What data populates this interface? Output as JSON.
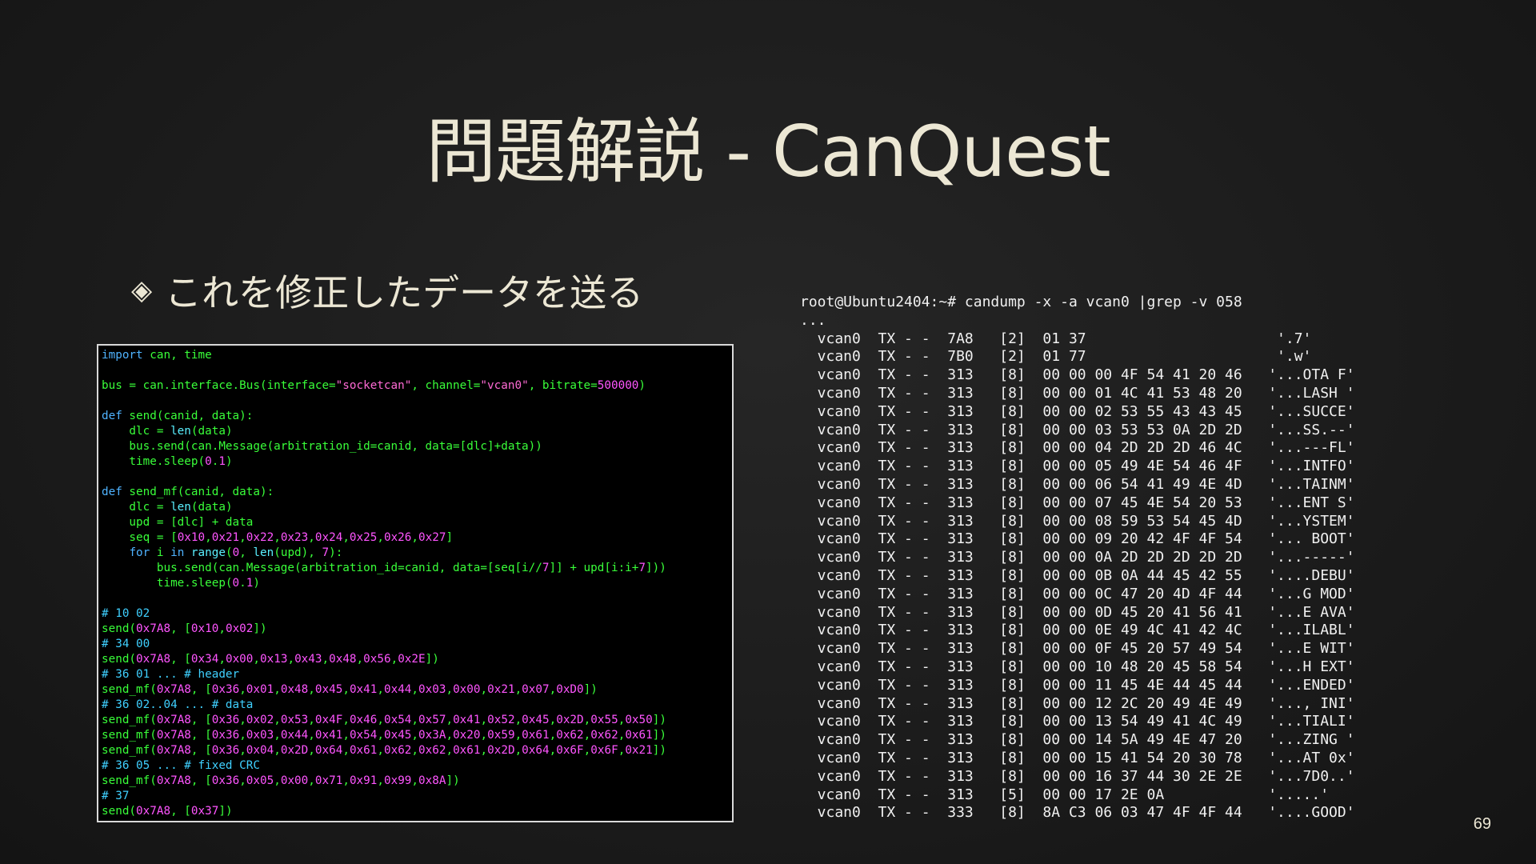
{
  "slide": {
    "title": "問題解説 - CanQuest",
    "bullet": "これを修正したデータを送る",
    "page_number": "69"
  },
  "code_lines": [
    "import can, time",
    "",
    "bus = can.interface.Bus(interface=\"socketcan\", channel=\"vcan0\", bitrate=500000)",
    "",
    "def send(canid, data):",
    "    dlc = len(data)",
    "    bus.send(can.Message(arbitration_id=canid, data=[dlc]+data))",
    "    time.sleep(0.1)",
    "",
    "def send_mf(canid, data):",
    "    dlc = len(data)",
    "    upd = [dlc] + data",
    "    seq = [0x10,0x21,0x22,0x23,0x24,0x25,0x26,0x27]",
    "    for i in range(0, len(upd), 7):",
    "        bus.send(can.Message(arbitration_id=canid, data=[seq[i//7]] + upd[i:i+7]))",
    "        time.sleep(0.1)",
    "",
    "# 10 02",
    "send(0x7A8, [0x10,0x02])",
    "# 34 00",
    "send(0x7A8, [0x34,0x00,0x13,0x43,0x48,0x56,0x2E])",
    "# 36 01 ... # header",
    "send_mf(0x7A8, [0x36,0x01,0x48,0x45,0x41,0x44,0x03,0x00,0x21,0x07,0xD0])",
    "# 36 02..04 ... # data",
    "send_mf(0x7A8, [0x36,0x02,0x53,0x4F,0x46,0x54,0x57,0x41,0x52,0x45,0x2D,0x55,0x50])",
    "send_mf(0x7A8, [0x36,0x03,0x44,0x41,0x54,0x45,0x3A,0x20,0x59,0x61,0x62,0x62,0x61])",
    "send_mf(0x7A8, [0x36,0x04,0x2D,0x64,0x61,0x62,0x62,0x61,0x2D,0x64,0x6F,0x6F,0x21])",
    "# 36 05 ... # fixed CRC",
    "send_mf(0x7A8, [0x36,0x05,0x00,0x71,0x91,0x99,0x8A])",
    "# 37",
    "send(0x7A8, [0x37])"
  ],
  "terminal_lines": [
    "root@Ubuntu2404:~# candump -x -a vcan0 |grep -v 058",
    "...",
    "  vcan0  TX - -  7A8   [2]  01 37                      '.7'",
    "  vcan0  TX - -  7B0   [2]  01 77                      '.w'",
    "  vcan0  TX - -  313   [8]  00 00 00 4F 54 41 20 46   '...OTA F'",
    "  vcan0  TX - -  313   [8]  00 00 01 4C 41 53 48 20   '...LASH '",
    "  vcan0  TX - -  313   [8]  00 00 02 53 55 43 43 45   '...SUCCE'",
    "  vcan0  TX - -  313   [8]  00 00 03 53 53 0A 2D 2D   '...SS.--'",
    "  vcan0  TX - -  313   [8]  00 00 04 2D 2D 2D 46 4C   '...---FL'",
    "  vcan0  TX - -  313   [8]  00 00 05 49 4E 54 46 4F   '...INTFO'",
    "  vcan0  TX - -  313   [8]  00 00 06 54 41 49 4E 4D   '...TAINM'",
    "  vcan0  TX - -  313   [8]  00 00 07 45 4E 54 20 53   '...ENT S'",
    "  vcan0  TX - -  313   [8]  00 00 08 59 53 54 45 4D   '...YSTEM'",
    "  vcan0  TX - -  313   [8]  00 00 09 20 42 4F 4F 54   '... BOOT'",
    "  vcan0  TX - -  313   [8]  00 00 0A 2D 2D 2D 2D 2D   '...-----'",
    "  vcan0  TX - -  313   [8]  00 00 0B 0A 44 45 42 55   '....DEBU'",
    "  vcan0  TX - -  313   [8]  00 00 0C 47 20 4D 4F 44   '...G MOD'",
    "  vcan0  TX - -  313   [8]  00 00 0D 45 20 41 56 41   '...E AVA'",
    "  vcan0  TX - -  313   [8]  00 00 0E 49 4C 41 42 4C   '...ILABL'",
    "  vcan0  TX - -  313   [8]  00 00 0F 45 20 57 49 54   '...E WIT'",
    "  vcan0  TX - -  313   [8]  00 00 10 48 20 45 58 54   '...H EXT'",
    "  vcan0  TX - -  313   [8]  00 00 11 45 4E 44 45 44   '...ENDED'",
    "  vcan0  TX - -  313   [8]  00 00 12 2C 20 49 4E 49   '..., INI'",
    "  vcan0  TX - -  313   [8]  00 00 13 54 49 41 4C 49   '...TIALI'",
    "  vcan0  TX - -  313   [8]  00 00 14 5A 49 4E 47 20   '...ZING '",
    "  vcan0  TX - -  313   [8]  00 00 15 41 54 20 30 78   '...AT 0x'",
    "  vcan0  TX - -  313   [8]  00 00 16 37 44 30 2E 2E   '...7D0..'",
    "  vcan0  TX - -  313   [5]  00 00 17 2E 0A            '.....'",
    "  vcan0  TX - -  333   [8]  8A C3 06 03 47 4F 4F 44   '....GOOD'"
  ]
}
